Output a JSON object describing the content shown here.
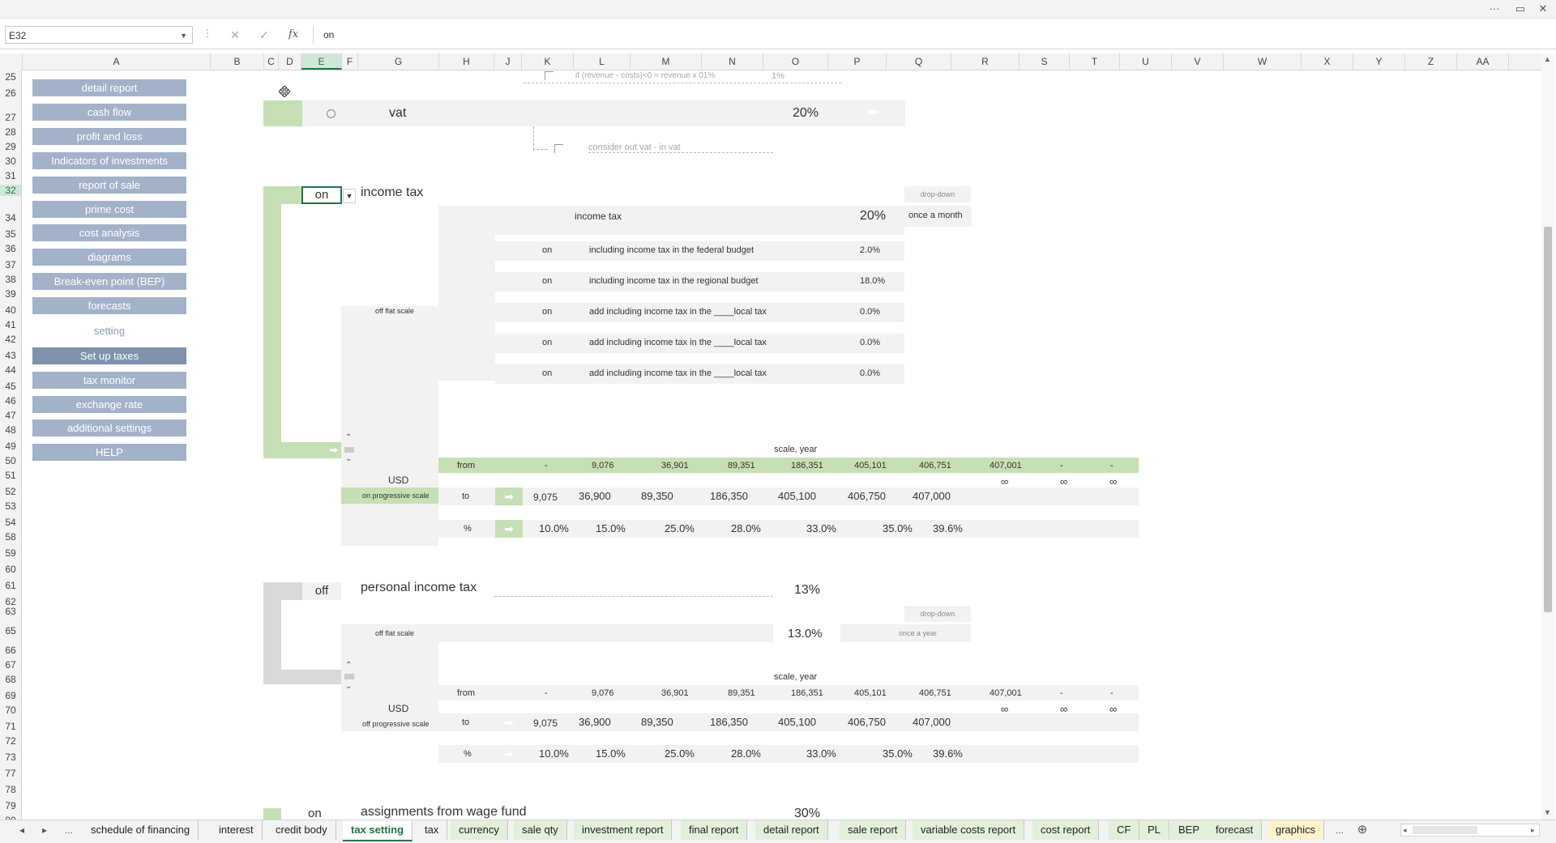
{
  "window": {
    "more_label": "···",
    "restore_label": "▭",
    "close_label": "✕"
  },
  "formula_bar": {
    "name_box": "E32",
    "cancel": "✕",
    "enter": "✓",
    "fx": "fx",
    "value": "on"
  },
  "columns": [
    "A",
    "B",
    "C",
    "D",
    "E",
    "F",
    "G",
    "H",
    "J",
    "K",
    "L",
    "M",
    "N",
    "O",
    "P",
    "Q",
    "R",
    "S",
    "T",
    "U",
    "V",
    "W",
    "X",
    "Y",
    "Z",
    "AA"
  ],
  "rows": [
    "25",
    "26",
    "27",
    "28",
    "29",
    "30",
    "31",
    "32",
    "34",
    "35",
    "36",
    "37",
    "38",
    "39",
    "40",
    "41",
    "42",
    "43",
    "44",
    "45",
    "46",
    "47",
    "48",
    "49",
    "50",
    "51",
    "52",
    "53",
    "54",
    "58",
    "59",
    "60",
    "61",
    "62",
    "63",
    "65",
    "66",
    "67",
    "68",
    "69",
    "70",
    "71",
    "72",
    "73",
    "77",
    "78",
    "79",
    "80"
  ],
  "nav": {
    "buttons": [
      "detail report",
      "cash flow",
      "profit and loss",
      "Indicators of investments",
      "report of sale",
      "prime cost",
      "cost analysis",
      "diagrams",
      "Break-even point (BEP)",
      "forecasts"
    ],
    "setting_label": "setting",
    "setting_buttons": [
      "Set up taxes",
      "tax monitor",
      "exchange rate",
      "additional settings",
      "HELP"
    ]
  },
  "top_block": {
    "revenue_note": "if (revenue - costs)<0 = revenue x 01%",
    "revenue_pct": "1%",
    "vat_label": "vat",
    "vat_value": "20%",
    "vat_note": "consider out vat - in vat"
  },
  "income_tax": {
    "toggle": "on",
    "title": "income tax",
    "dropdown_label": "drop-down",
    "header_label": "income tax",
    "header_value": "20%",
    "frequency": "once a month",
    "lines": [
      {
        "state": "on",
        "label": "including income tax in the federal budget",
        "value": "2.0%"
      },
      {
        "state": "on",
        "label": "including income tax in the regional budget",
        "value": "18.0%"
      },
      {
        "state": "on",
        "label": "add including income tax in the ____local tax",
        "value": "0.0%"
      },
      {
        "state": "on",
        "label": "add including income tax in the ____local tax",
        "value": "0.0%"
      },
      {
        "state": "on",
        "label": "add including income tax in the ____local tax",
        "value": "0.0%"
      }
    ],
    "flat_scale": "off flat scale",
    "scale_title": "scale, year",
    "currency": "USD",
    "progressive": "on progressive scale",
    "from_label": "from",
    "to_label": "to",
    "pct_label": "%",
    "from": [
      "-",
      "9,076",
      "36,901",
      "89,351",
      "186,351",
      "405,101",
      "406,751",
      "407,001",
      "-",
      "-"
    ],
    "infinity": [
      "∞",
      "∞",
      "∞"
    ],
    "to": [
      "9,075",
      "36,900",
      "89,350",
      "186,350",
      "405,100",
      "406,750",
      "407,000"
    ],
    "pct": [
      "10.0%",
      "15.0%",
      "25.0%",
      "28.0%",
      "33.0%",
      "35.0%",
      "39.6%"
    ]
  },
  "personal_tax": {
    "toggle": "off",
    "title": "personal income tax",
    "value": "13%",
    "dropdown_label": "drop-down",
    "flat_scale": "off flat scale",
    "flat_value": "13.0%",
    "frequency": "once a year",
    "scale_title": "scale, year",
    "currency": "USD",
    "progressive": "off progressive scale",
    "from_label": "from",
    "to_label": "to",
    "pct_label": "%",
    "from": [
      "-",
      "9,076",
      "36,901",
      "89,351",
      "186,351",
      "405,101",
      "406,751",
      "407,001",
      "-",
      "-"
    ],
    "infinity": [
      "∞",
      "∞",
      "∞"
    ],
    "to": [
      "9,075",
      "36,900",
      "89,350",
      "186,350",
      "405,100",
      "406,750",
      "407,000"
    ],
    "pct": [
      "10.0%",
      "15.0%",
      "25.0%",
      "28.0%",
      "33.0%",
      "35.0%",
      "39.6%"
    ]
  },
  "wage_fund": {
    "toggle": "on",
    "title": "assignments from wage fund",
    "value": "30%"
  },
  "sheet_tabs": {
    "nav_prev": "◂",
    "nav_next": "▸",
    "more_left": "...",
    "more_right": "...",
    "add": "⊕",
    "tabs": [
      "schedule of financing",
      "interest",
      "credit body",
      "tax setting",
      "tax",
      "currency",
      "sale qty",
      "investment report",
      "final report",
      "detail report",
      "sale report",
      "variable costs report",
      "cost report",
      "CF",
      "PL",
      "BEP",
      "forecast",
      "graphics"
    ]
  },
  "colors": {
    "accent": "#217346",
    "green_fill": "#c6dfb4",
    "nav_button": "#a3b2c9",
    "nav_active": "#7f91ad"
  }
}
